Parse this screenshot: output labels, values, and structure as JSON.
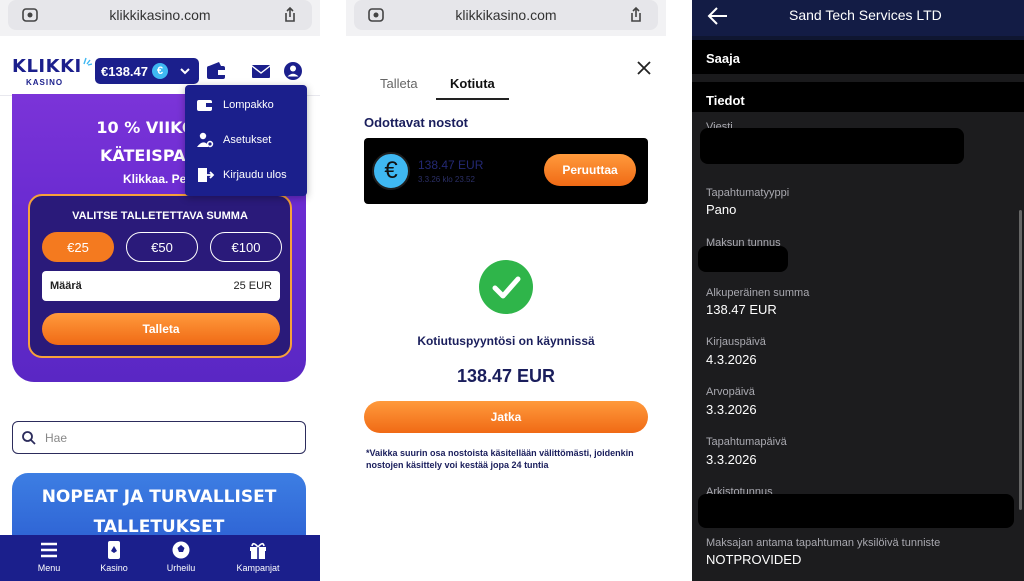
{
  "panel1": {
    "browser": {
      "url": "klikkikasino.com"
    },
    "logo": {
      "main": "KLIKKI",
      "sub": "KASINO"
    },
    "balance": {
      "amount": "€138.47",
      "coin": "€"
    },
    "menu": {
      "items": [
        {
          "label": "Lompakko"
        },
        {
          "label": "Asetukset"
        },
        {
          "label": "Kirjaudu ulos"
        }
      ]
    },
    "hero": {
      "title1": "10 % VIIKOITT",
      "title2": "KÄTEISPALA",
      "subtitle": "Klikkaa. Pelaa"
    },
    "deposit": {
      "title": "VALITSE TALLETETTAVA SUMMA",
      "amounts": [
        "€25",
        "€50",
        "€100"
      ],
      "selected": "€25",
      "field_label": "Määrä",
      "field_value": "25 EUR",
      "submit": "Talleta"
    },
    "search": {
      "placeholder": "Hae"
    },
    "promo": {
      "line1": "NOPEAT JA TURVALLISET",
      "line2": "TALLETUKSET"
    },
    "nav": [
      {
        "label": "Menu"
      },
      {
        "label": "Kasino"
      },
      {
        "label": "Urheilu"
      },
      {
        "label": "Kampanjat"
      }
    ]
  },
  "panel2": {
    "browser": {
      "url": "klikkikasino.com"
    },
    "tabs": [
      {
        "label": "Talleta"
      },
      {
        "label": "Kotiuta"
      }
    ],
    "active_tab": "Kotiuta",
    "pending_title": "Odottavat nostot",
    "pending": {
      "amount": "138.47 EUR",
      "time": "3.3.26 klo 23.52",
      "cancel": "Peruuttaa",
      "coin": "€"
    },
    "status": "Kotiutuspyyntösi on käynnissä",
    "amount": "138.47 EUR",
    "continue": "Jatka",
    "note": "*Vaikka suurin osa nostoista käsitellään välittömästi, joidenkin nostojen käsittely voi kestää jopa 24 tuntia"
  },
  "panel3": {
    "title": "Sand Tech Services LTD",
    "sections": {
      "recipient": "Saaja",
      "details": "Tiedot"
    },
    "fields": [
      {
        "label": "Viesti",
        "value": ""
      },
      {
        "label": "Tapahtumatyyppi",
        "value": "Pano"
      },
      {
        "label": "Maksun tunnus",
        "value": ""
      },
      {
        "label": "Alkuperäinen summa",
        "value": "138.47 EUR"
      },
      {
        "label": "Kirjauspäivä",
        "value": "4.3.2026"
      },
      {
        "label": "Arvopäivä",
        "value": "3.3.2026"
      },
      {
        "label": "Tapahtumapäivä",
        "value": "3.3.2026"
      },
      {
        "label": "Arkistotunnus",
        "value": ""
      },
      {
        "label": "Maksajan antama tapahtuman yksilöivä tunniste",
        "value": "NOTPROVIDED"
      }
    ]
  },
  "colors": {
    "brand_navy": "#1b1f8c",
    "accent_orange": "#f47a1f",
    "hero_purple": "#6a2bd1",
    "success_green": "#2fb54a",
    "bank_bg": "#1c1c1e"
  }
}
